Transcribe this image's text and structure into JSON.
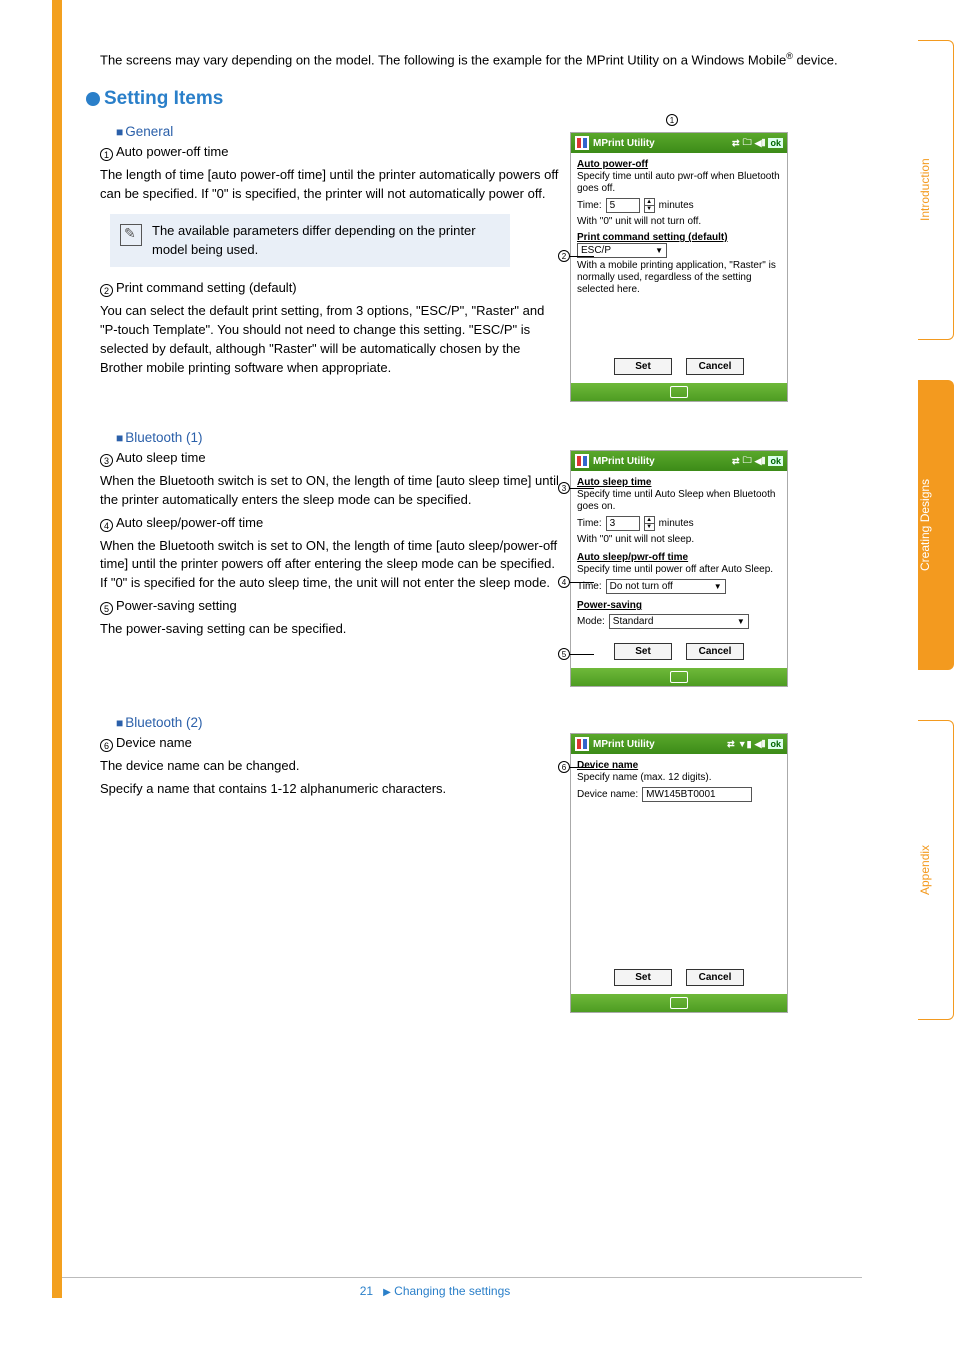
{
  "intro_text1": "The screens may vary depending on the model. The following is the example for the MPrint Utility on a Windows Mobile",
  "intro_sup": "®",
  "intro_text2": " device.",
  "h2": "Setting Items",
  "general": {
    "title": "General",
    "item1_n": "1",
    "item1_h": "Auto power-off time",
    "item1_p": "The length of time [auto power-off time] until the printer automatically powers off can be specified. If \"0\" is specified, the printer will not automatically power off.",
    "note": "The available parameters differ depending on the printer model being used.",
    "item2_n": "2",
    "item2_h": "Print command setting (default)",
    "item2_p": "You can select the default print setting, from 3 options, \"ESC/P\", \"Raster\" and \"P-touch Template\". You should not need to change this setting. \"ESC/P\" is selected by default, although \"Raster\" will be automatically chosen by the Brother mobile printing software when appropriate."
  },
  "bt1": {
    "title": "Bluetooth (1)",
    "item3_n": "3",
    "item3_h": "Auto sleep time",
    "item3_p": "When the Bluetooth switch is set to ON, the length of time [auto sleep time] until the printer automatically enters the sleep mode can be specified.",
    "item4_n": "4",
    "item4_h": "Auto sleep/power-off time",
    "item4_p": "When the Bluetooth switch is set to ON, the length of time [auto sleep/power-off time] until the printer powers off after entering the sleep mode can be specified. If \"0\" is specified for the auto sleep time, the unit will not enter the sleep mode.",
    "item5_n": "5",
    "item5_h": "Power-saving setting",
    "item5_p": "The power-saving setting can be specified."
  },
  "bt2": {
    "title": "Bluetooth (2)",
    "item6_n": "6",
    "item6_h": "Device name",
    "item6_p1": "The device name can be changed.",
    "item6_p2": "Specify a name that contains 1-12 alphanumeric characters."
  },
  "phone_a": {
    "title": "MPrint Utility",
    "tb_ok": "ok",
    "g1_title": "Auto power-off",
    "g1_l1": "Specify time until auto pwr-off when Bluetooth goes off.",
    "g1_time_lbl": "Time:",
    "g1_time_val": "5",
    "g1_time_unit": "minutes",
    "g1_l2": "With \"0\" unit will not turn off.",
    "g2_title": "Print command setting (default)",
    "g2_dd": "ESC/P",
    "g2_l1": "With a mobile printing application, \"Raster\" is normally used, regardless of the setting selected here.",
    "btn_set": "Set",
    "btn_cancel": "Cancel"
  },
  "phone_b": {
    "title": "MPrint Utility",
    "tb_ok": "ok",
    "g3_title": "Auto sleep time",
    "g3_l1": "Specify time until Auto Sleep when Bluetooth goes on.",
    "g3_time_lbl": "Time:",
    "g3_time_val": "3",
    "g3_time_unit": "minutes",
    "g3_l2": "With \"0\" unit will not sleep.",
    "g4_title": "Auto sleep/pwr-off time",
    "g4_l1": "Specify time until power off after Auto Sleep.",
    "g4_time_lbl": "Time:",
    "g4_dd": "Do not turn off",
    "g5_title": "Power-saving",
    "g5_mode_lbl": "Mode:",
    "g5_dd": "Standard",
    "btn_set": "Set",
    "btn_cancel": "Cancel"
  },
  "phone_c": {
    "title": "MPrint Utility",
    "tb_ok": "ok",
    "g6_title": "Device name",
    "g6_l1": "Specify name (max. 12 digits).",
    "g6_name_lbl": "Device name:",
    "g6_name_val": "MW145BT0001",
    "btn_set": "Set",
    "btn_cancel": "Cancel"
  },
  "tabs": {
    "intro": "Introduction",
    "create": "Creating Designs",
    "appx": "Appendix"
  },
  "footer": {
    "page": "21",
    "text": "Changing the settings"
  },
  "callouts": {
    "c1": "1",
    "c2": "2",
    "c3": "3",
    "c4": "4",
    "c5": "5",
    "c6": "6"
  }
}
